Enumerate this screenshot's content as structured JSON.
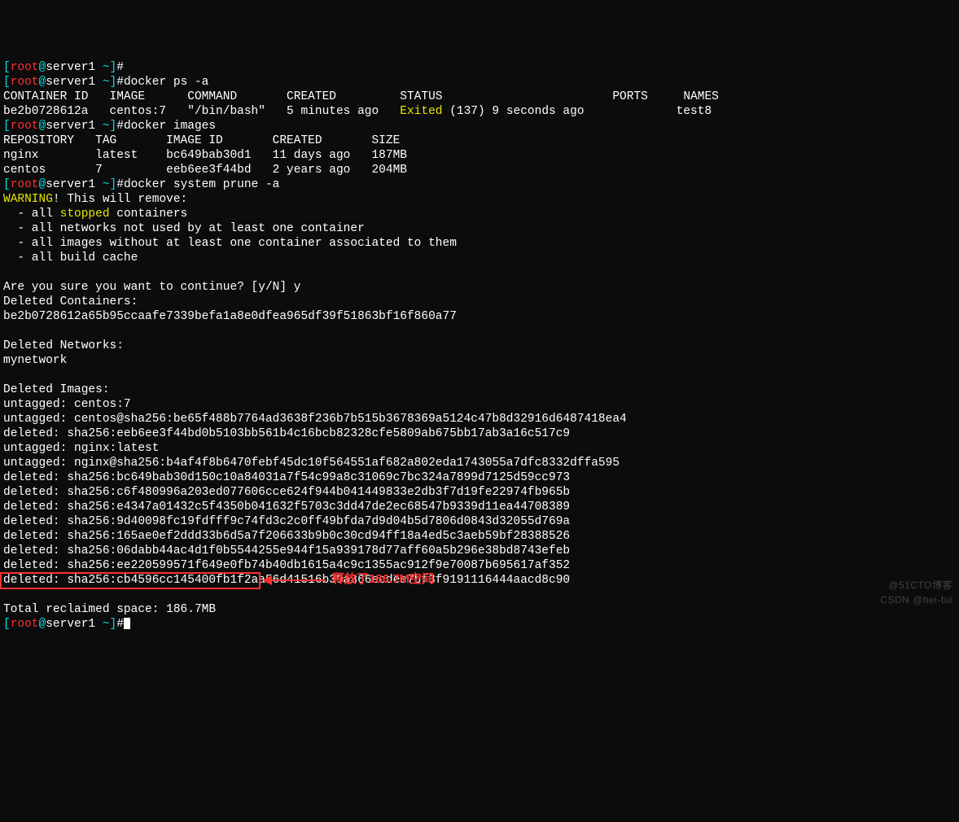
{
  "prompt": {
    "open": "[",
    "user": "root",
    "at": "@",
    "host": "server1",
    "dir": " ~",
    "close": "]",
    "hash": "#"
  },
  "headers": {
    "ps": "CONTAINER ID   IMAGE      COMMAND       CREATED         STATUS                        PORTS     NAMES",
    "images": "REPOSITORY   TAG       IMAGE ID       CREATED       SIZE"
  },
  "rows": {
    "ps1_a": "be2b0728612a   centos:7   \"/bin/bash\"   5 minutes ago   ",
    "ps1_exited": "Exited",
    "ps1_b": " (137) 9 seconds ago             test8",
    "img1": "nginx        latest    bc649bab30d1   11 days ago   187MB",
    "img2": "centos       7         eeb6ee3f44bd   2 years ago   204MB"
  },
  "cmds": {
    "c1": "",
    "c2": "docker ps -a",
    "c3": "docker images",
    "c4": "docker system prune -a"
  },
  "warn": {
    "w1": "WARNING",
    "w2": "! This will remove:",
    "b1": "  - all ",
    "stopped": "stopped",
    "b1b": " containers",
    "b2": "  - all networks not used by at least one container",
    "b3": "  - all images without at least one container associated to them",
    "b4": "  - all build cache"
  },
  "confirm": "Are you sure you want to continue? [y/N] y",
  "del": {
    "dc_h": "Deleted Containers:",
    "dc_1": "be2b0728612a65b95ccaafe7339befa1a8e0dfea965df39f51863bf16f860a77",
    "dn_h": "Deleted Networks:",
    "dn_1": "mynetwork",
    "di_h": "Deleted Images:",
    "di_01": "untagged: centos:7",
    "di_02": "untagged: centos@sha256:be65f488b7764ad3638f236b7b515b3678369a5124c47b8d32916d6487418ea4",
    "di_03": "deleted: sha256:eeb6ee3f44bd0b5103bb561b4c16bcb82328cfe5809ab675bb17ab3a16c517c9",
    "di_04": "untagged: nginx:latest",
    "di_05": "untagged: nginx@sha256:b4af4f8b6470febf45dc10f564551af682a802eda1743055a7dfc8332dffa595",
    "di_06": "deleted: sha256:bc649bab30d150c10a84031a7f54c99a8c31069c7bc324a7899d7125d59cc973",
    "di_07": "deleted: sha256:c6f480996a203ed077606cce624f944b041449833e2db3f7d19fe22974fb965b",
    "di_08": "deleted: sha256:e4347a01432c5f4350b041632f5703c3dd47de2ec68547b9339d11ea44708389",
    "di_09": "deleted: sha256:9d40098fc19fdfff9c74fd3c2c0ff49bfda7d9d04b5d7806d0843d32055d769a",
    "di_10": "deleted: sha256:165ae0ef2ddd33b6d5a7f206633b9b0c30cd94ff18a4ed5c3aeb59bf28388526",
    "di_11": "deleted: sha256:06dabb44ac4d1f0b5544255e944f15a939178d77aff60a5b296e38bd8743efeb",
    "di_12": "deleted: sha256:ee220599571f649e0fb74b40db1615a4c9c1355ac912f9e70087b695617af352",
    "di_13": "deleted: sha256:cb4596cc145400fb1f2aa56d41516b39a366ecdee7bf3f9191116444aacd8c90"
  },
  "total": "Total reclaimed space: 186.7MB",
  "annotation": "释放了186.7M空间",
  "watermark1": "@51CTO博客",
  "watermark2": "CSDN @hei-tui"
}
